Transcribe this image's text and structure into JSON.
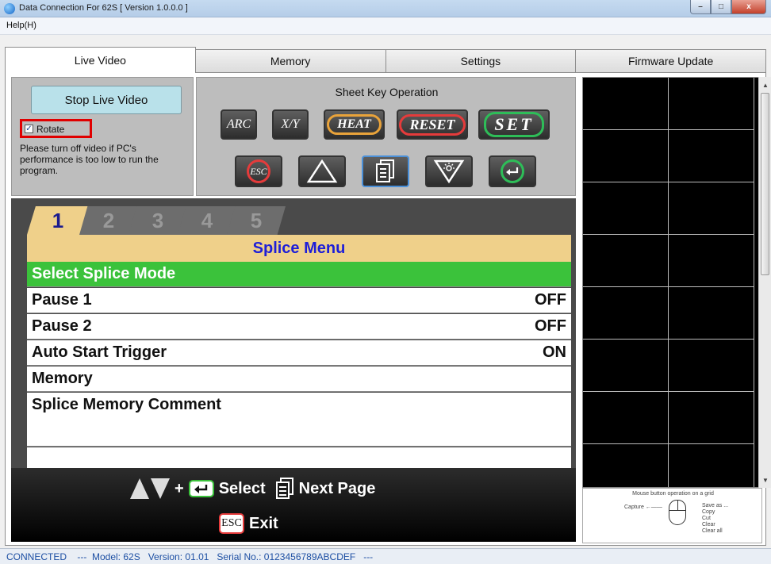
{
  "window": {
    "title": "Data Connection For 62S [ Version 1.0.0.0 ]",
    "minimize": "–",
    "maximize": "□",
    "close": "x"
  },
  "menubar": {
    "help": "Help(H)"
  },
  "tabs": [
    {
      "label": "Live Video",
      "active": true
    },
    {
      "label": "Memory",
      "active": false
    },
    {
      "label": "Settings",
      "active": false
    },
    {
      "label": "Firmware Update",
      "active": false
    }
  ],
  "control": {
    "stop_button": "Stop Live Video",
    "rotate_checked": true,
    "rotate_label": "Rotate",
    "warning": "Please turn off video if PC's performance is too low to run the program."
  },
  "sheet_keys": {
    "title": "Sheet Key Operation",
    "arc": "ARC",
    "xy": "X/Y",
    "heat": "HEAT",
    "reset": "RESET",
    "set": "SET",
    "esc": "ESC"
  },
  "monitor": {
    "page_tabs": [
      "1",
      "2",
      "3",
      "4",
      "5"
    ],
    "active_page": "1",
    "menu_title": "Splice Menu",
    "rows": [
      {
        "label": "Select Splice Mode",
        "value": "",
        "selected": true
      },
      {
        "label": "Pause 1",
        "value": "OFF",
        "selected": false
      },
      {
        "label": "Pause 2",
        "value": "OFF",
        "selected": false
      },
      {
        "label": "Auto Start Trigger",
        "value": "ON",
        "selected": false
      },
      {
        "label": "Memory",
        "value": "",
        "selected": false
      },
      {
        "label": "Splice Memory Comment",
        "value": "",
        "selected": false
      }
    ],
    "guide_select": "Select",
    "guide_next": "Next Page",
    "guide_plus": "+",
    "guide_esc": "ESC",
    "guide_exit": "Exit"
  },
  "mouse_help": {
    "title": "Mouse button operation on a grid",
    "capture": "Capture",
    "options": [
      "Save as ...",
      "Copy",
      "Cut",
      "Clear",
      "Clear all"
    ]
  },
  "status": {
    "text": "CONNECTED    ---  Model: 62S   Version: 01.01   Serial No.: 0123456789ABCDEF   ---"
  },
  "colors": {
    "accent_yellow": "#efd08a",
    "selected_green": "#3bc23b",
    "title_blue": "#1e1ed8",
    "highlight_red": "#e00000"
  }
}
